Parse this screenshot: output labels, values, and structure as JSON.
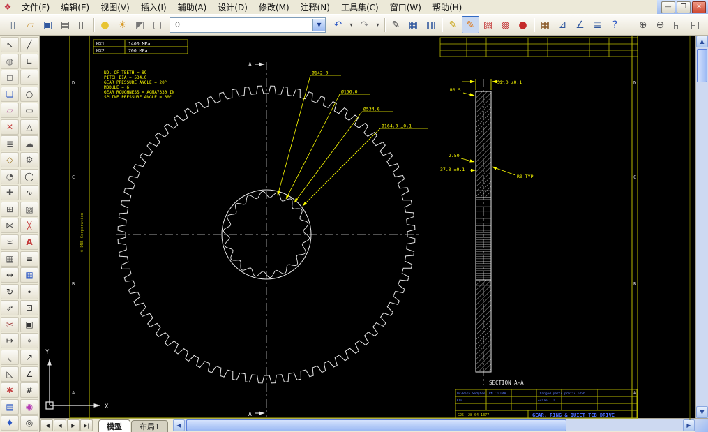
{
  "menu": {
    "items": [
      "文件(F)",
      "编辑(E)",
      "视图(V)",
      "插入(I)",
      "辅助(A)",
      "设计(D)",
      "修改(M)",
      "注释(N)",
      "工具集(C)",
      "窗口(W)",
      "帮助(H)"
    ]
  },
  "window_controls": {
    "minimize": "—",
    "restore": "❐",
    "close": "✕"
  },
  "toolbar": {
    "layer_value": "0",
    "drop_glyph": "▼",
    "g1": [
      {
        "n": "new-file",
        "g": "▯",
        "c": "#445a7a"
      },
      {
        "n": "open-file",
        "g": "▱",
        "c": "#c89232"
      },
      {
        "n": "save-file",
        "g": "▣",
        "c": "#31589e"
      },
      {
        "n": "print",
        "g": "▤",
        "c": "#555555"
      },
      {
        "n": "print-preview",
        "g": "◫",
        "c": "#555555"
      },
      {
        "t": "sep"
      },
      {
        "n": "layer-bulb",
        "g": "●",
        "c": "#e8c431"
      },
      {
        "n": "layer-freeze",
        "g": "☀",
        "c": "#d89a27"
      },
      {
        "n": "layer-lock",
        "g": "◩",
        "c": "#777777"
      },
      {
        "n": "color-swatch",
        "g": "▢",
        "c": "#666666"
      }
    ],
    "g2": [
      {
        "n": "undo",
        "g": "↶",
        "c": "#2b57c4"
      },
      {
        "n": "undo-caret",
        "g": "▾",
        "c": "#444444",
        "w": 1
      },
      {
        "n": "redo",
        "g": "↷",
        "c": "#8a8a8a"
      },
      {
        "n": "redo-caret",
        "g": "▾",
        "c": "#444444",
        "w": 1
      },
      {
        "t": "sep"
      },
      {
        "n": "edit-properties",
        "g": "✎",
        "c": "#4a4a4a"
      },
      {
        "n": "table-style",
        "g": "▦",
        "c": "#31589e"
      },
      {
        "n": "sheet-set",
        "g": "▥",
        "c": "#31589e"
      },
      {
        "t": "sep"
      },
      {
        "n": "markup-pencil",
        "g": "✎",
        "c": "#c8a516"
      },
      {
        "n": "markup-highlight",
        "g": "✎",
        "c": "#de7a1c",
        "a": 1
      },
      {
        "n": "markup-hatch",
        "g": "▨",
        "c": "#c43b3b"
      },
      {
        "n": "markup-bricks",
        "g": "▩",
        "c": "#c43b3b"
      },
      {
        "n": "markup-record",
        "g": "●",
        "c": "#c42a2a"
      },
      {
        "t": "sep"
      },
      {
        "n": "table-edit",
        "g": "▦",
        "c": "#8a5a2a"
      },
      {
        "n": "measure-distance",
        "g": "⊿",
        "c": "#31589e"
      },
      {
        "n": "measure-angle",
        "g": "∠",
        "c": "#31589e"
      },
      {
        "n": "layer-list",
        "g": "≣",
        "c": "#31589e"
      },
      {
        "n": "help",
        "g": "?",
        "c": "#2b57c4"
      }
    ],
    "g3": [
      {
        "n": "zoom-realtime",
        "g": "⊕",
        "c": "#555555"
      },
      {
        "n": "zoom-out",
        "g": "⊖",
        "c": "#555555"
      },
      {
        "n": "zoom-window",
        "g": "◱",
        "c": "#555555"
      },
      {
        "n": "zoom-extents",
        "g": "◰",
        "c": "#555555"
      }
    ]
  },
  "palette": {
    "col1": [
      {
        "n": "select-arrow",
        "g": "↖",
        "c": "#333333"
      },
      {
        "n": "quick-select",
        "g": "◍",
        "c": "#666666"
      },
      {
        "n": "zoom-box",
        "g": "◻",
        "c": "#666666"
      },
      {
        "n": "tool-palette",
        "g": "❏",
        "c": "#2b57c4"
      },
      {
        "n": "eraser",
        "g": "▱",
        "c": "#b45a9a"
      },
      {
        "n": "delete",
        "g": "✕",
        "c": "#c43b3b"
      },
      {
        "n": "layer-stack",
        "g": "≣",
        "c": "#555555"
      },
      {
        "n": "box-3d",
        "g": "◇",
        "c": "#9a7422"
      },
      {
        "n": "orbit",
        "g": "◔",
        "c": "#555555"
      },
      {
        "n": "pan",
        "g": "✚",
        "c": "#555555"
      },
      {
        "n": "copy",
        "g": "⊞",
        "c": "#555555"
      },
      {
        "n": "mirror",
        "g": "⋈",
        "c": "#555555"
      },
      {
        "n": "offset",
        "g": "≍",
        "c": "#555555"
      },
      {
        "n": "array",
        "g": "▦",
        "c": "#555555"
      },
      {
        "n": "move",
        "g": "↔",
        "c": "#333333"
      },
      {
        "n": "rotate",
        "g": "↻",
        "c": "#333333"
      },
      {
        "n": "scale",
        "g": "⇗",
        "c": "#333333"
      },
      {
        "n": "trim",
        "g": "✂",
        "c": "#a03a3a"
      },
      {
        "n": "extend",
        "g": "↦",
        "c": "#333333"
      },
      {
        "n": "fillet",
        "g": "◟",
        "c": "#333333"
      },
      {
        "n": "chamfer",
        "g": "◺",
        "c": "#333333"
      },
      {
        "n": "explode",
        "g": "✱",
        "c": "#c44444"
      },
      {
        "n": "properties",
        "g": "▤",
        "c": "#2b57c4"
      },
      {
        "n": "match-properties",
        "g": "♦",
        "c": "#2b57c4"
      }
    ],
    "col2": [
      {
        "n": "line",
        "g": "╱",
        "c": "#333333"
      },
      {
        "n": "polyline",
        "g": "∟",
        "c": "#333333"
      },
      {
        "n": "arc",
        "g": "◜",
        "c": "#333333"
      },
      {
        "n": "circle",
        "g": "○",
        "c": "#333333"
      },
      {
        "n": "rectangle",
        "g": "▭",
        "c": "#333333"
      },
      {
        "n": "polygon",
        "g": "△",
        "c": "#333333"
      },
      {
        "n": "revision-cloud",
        "g": "☁",
        "c": "#555555"
      },
      {
        "n": "gear-tool",
        "g": "⚙",
        "c": "#555555"
      },
      {
        "n": "ellipse",
        "g": "◯",
        "c": "#333333"
      },
      {
        "n": "spline",
        "g": "∿",
        "c": "#333333"
      },
      {
        "n": "hatch",
        "g": "▨",
        "c": "#555555"
      },
      {
        "n": "break",
        "g": "╳",
        "c": "#c43b3b"
      },
      {
        "n": "text",
        "g": "A",
        "c": "#c43b3b"
      },
      {
        "n": "mtext",
        "g": "≡",
        "c": "#333333"
      },
      {
        "n": "table",
        "g": "▦",
        "c": "#2b57c4"
      },
      {
        "n": "point",
        "g": "∙",
        "c": "#333333"
      },
      {
        "n": "block",
        "g": "⊡",
        "c": "#333333"
      },
      {
        "n": "insert-block",
        "g": "▣",
        "c": "#333333"
      },
      {
        "n": "dimension",
        "g": "⌖",
        "c": "#333333"
      },
      {
        "n": "leader",
        "g": "↗",
        "c": "#333333"
      },
      {
        "n": "angular-dim",
        "g": "∠",
        "c": "#333333"
      },
      {
        "n": "grid",
        "g": "#",
        "c": "#333333"
      },
      {
        "n": "color-wheel",
        "g": "◉",
        "c": "#b43bb4"
      },
      {
        "n": "osnap",
        "g": "◎",
        "c": "#333333"
      }
    ]
  },
  "canvas": {
    "hx_table": {
      "r1c1": "HX1",
      "r1c2": "1400 MPa",
      "r2c1": "HX2",
      "r2c2": "700 MPa"
    },
    "notes": [
      "NO. OF TEETH = 89",
      "PITCH DIA = 534.0",
      "GEAR PRESSURE ANGLE = 20°",
      "MODULE = 6",
      "GEAR ROUGHNESS = AGMA7330 IN",
      "SPLINE PRESSURE ANGLE = 30°"
    ],
    "dims": {
      "bore1": "Ø142.0",
      "bore2": "Ø156.0",
      "pitch": "Ø534.0",
      "bore3": "Ø164.0 ±0.1",
      "width": "32.0 ±0.1",
      "radius_small": "R0.5",
      "step": "2.50",
      "hub": "37.0 ±0.1",
      "r0": "R0 TYP"
    },
    "section_label": "SECTION  A-A",
    "section_marker": "A",
    "zones": [
      "D",
      "C",
      "B",
      "A"
    ],
    "copyright": "© DNE Corporation",
    "ucs": {
      "x": "X",
      "y": "Y"
    },
    "title_block": {
      "company": "Dr-Reza Sedghee IRN CO LAB",
      "prefix": "Changed parts prefix 675b",
      "code": "KC0",
      "scale": "Scale 1:1",
      "sheet": "G25",
      "date": "28-04-1377",
      "title": "GEAR, RING & QUIET TCB DRIVE"
    }
  },
  "tabs": {
    "nav": [
      "|◀",
      "◀",
      "▶",
      "▶|"
    ],
    "items": [
      {
        "label": "模型",
        "active": true
      },
      {
        "label": "布局1",
        "active": false
      }
    ]
  },
  "scroll": {
    "up": "▲",
    "down": "▼",
    "left": "◀",
    "right": "▶"
  }
}
